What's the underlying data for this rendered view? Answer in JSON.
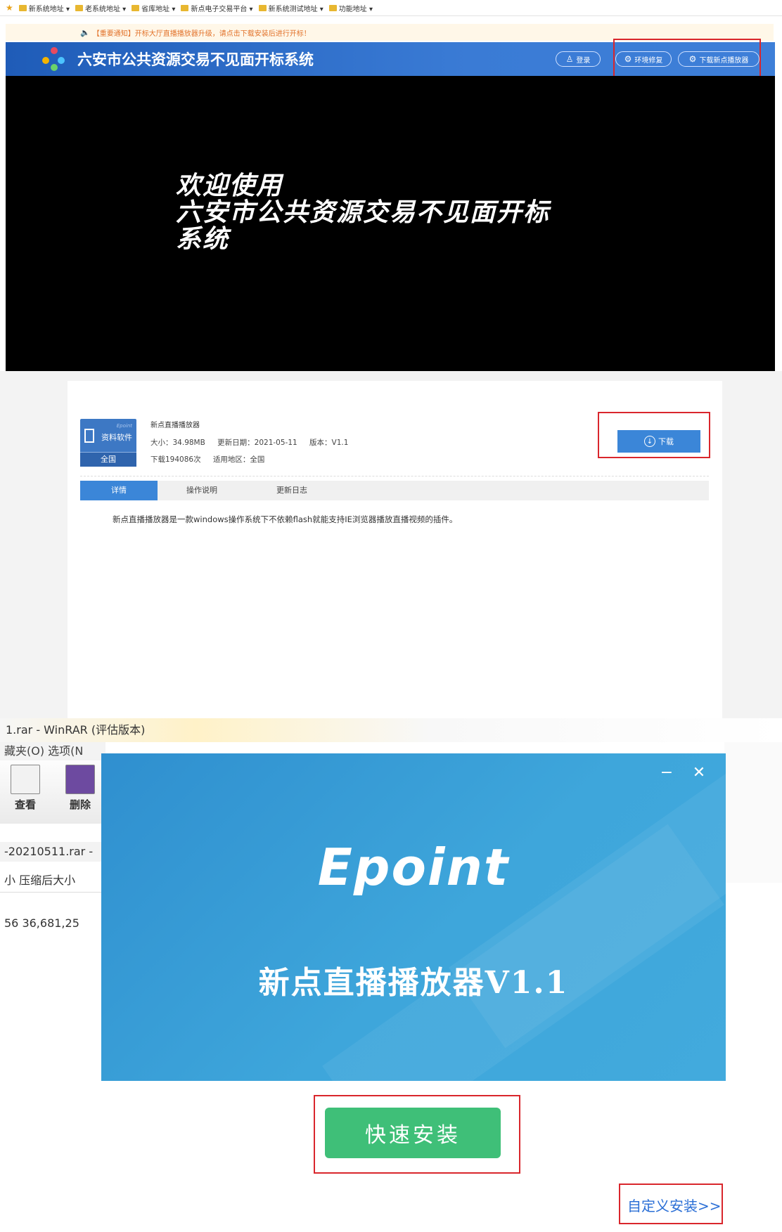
{
  "portal": {
    "bookmarks": [
      "新系统地址 ▾",
      "老系统地址 ▾",
      "省库地址 ▾",
      "新点电子交易平台 ▾",
      "新系统测试地址 ▾",
      "功能地址 ▾"
    ],
    "notice": "【重要通知】开标大厅直播播放器升级，请点击下载安装后进行开标！",
    "title": "六安市公共资源交易不见面开标系统",
    "login": "登录",
    "env_repair": "环境修复",
    "download_player": "下载新点播放器",
    "welcome_line1": "欢迎使用",
    "welcome_line2": "六安市公共资源交易不见面开标",
    "welcome_line3": "系统"
  },
  "download_page": {
    "icon_brand": "Epoint",
    "icon_category": "资料软件",
    "icon_region": "全国",
    "product_name": "新点直播播放器",
    "size": "大小：34.98MB",
    "updated": "更新日期：2021-05-11",
    "version": "版本：V1.1",
    "downloads": "下载194086次",
    "region": "适用地区：全国",
    "download_btn": "下载",
    "tabs": [
      "详情",
      "操作说明",
      "更新日志"
    ],
    "description": "新点直播播放器是一款windows操作系统下不依赖flash就能支持IE浏览器播放直播视频的插件。"
  },
  "installer": {
    "winrar_title": "1.rar - WinRAR (评估版本)",
    "winrar_menu": "藏夹(O)  选项(N",
    "tool_view": "查看",
    "tool_delete": "删除",
    "path": "-20210511.rar -",
    "columns": "小   压缩后大小",
    "row": "56   36,681,25",
    "brand": "Epoint",
    "product": "新点直播播放器V1.1",
    "quick_install": "快速安装",
    "custom_install": "自定义安装>>"
  }
}
